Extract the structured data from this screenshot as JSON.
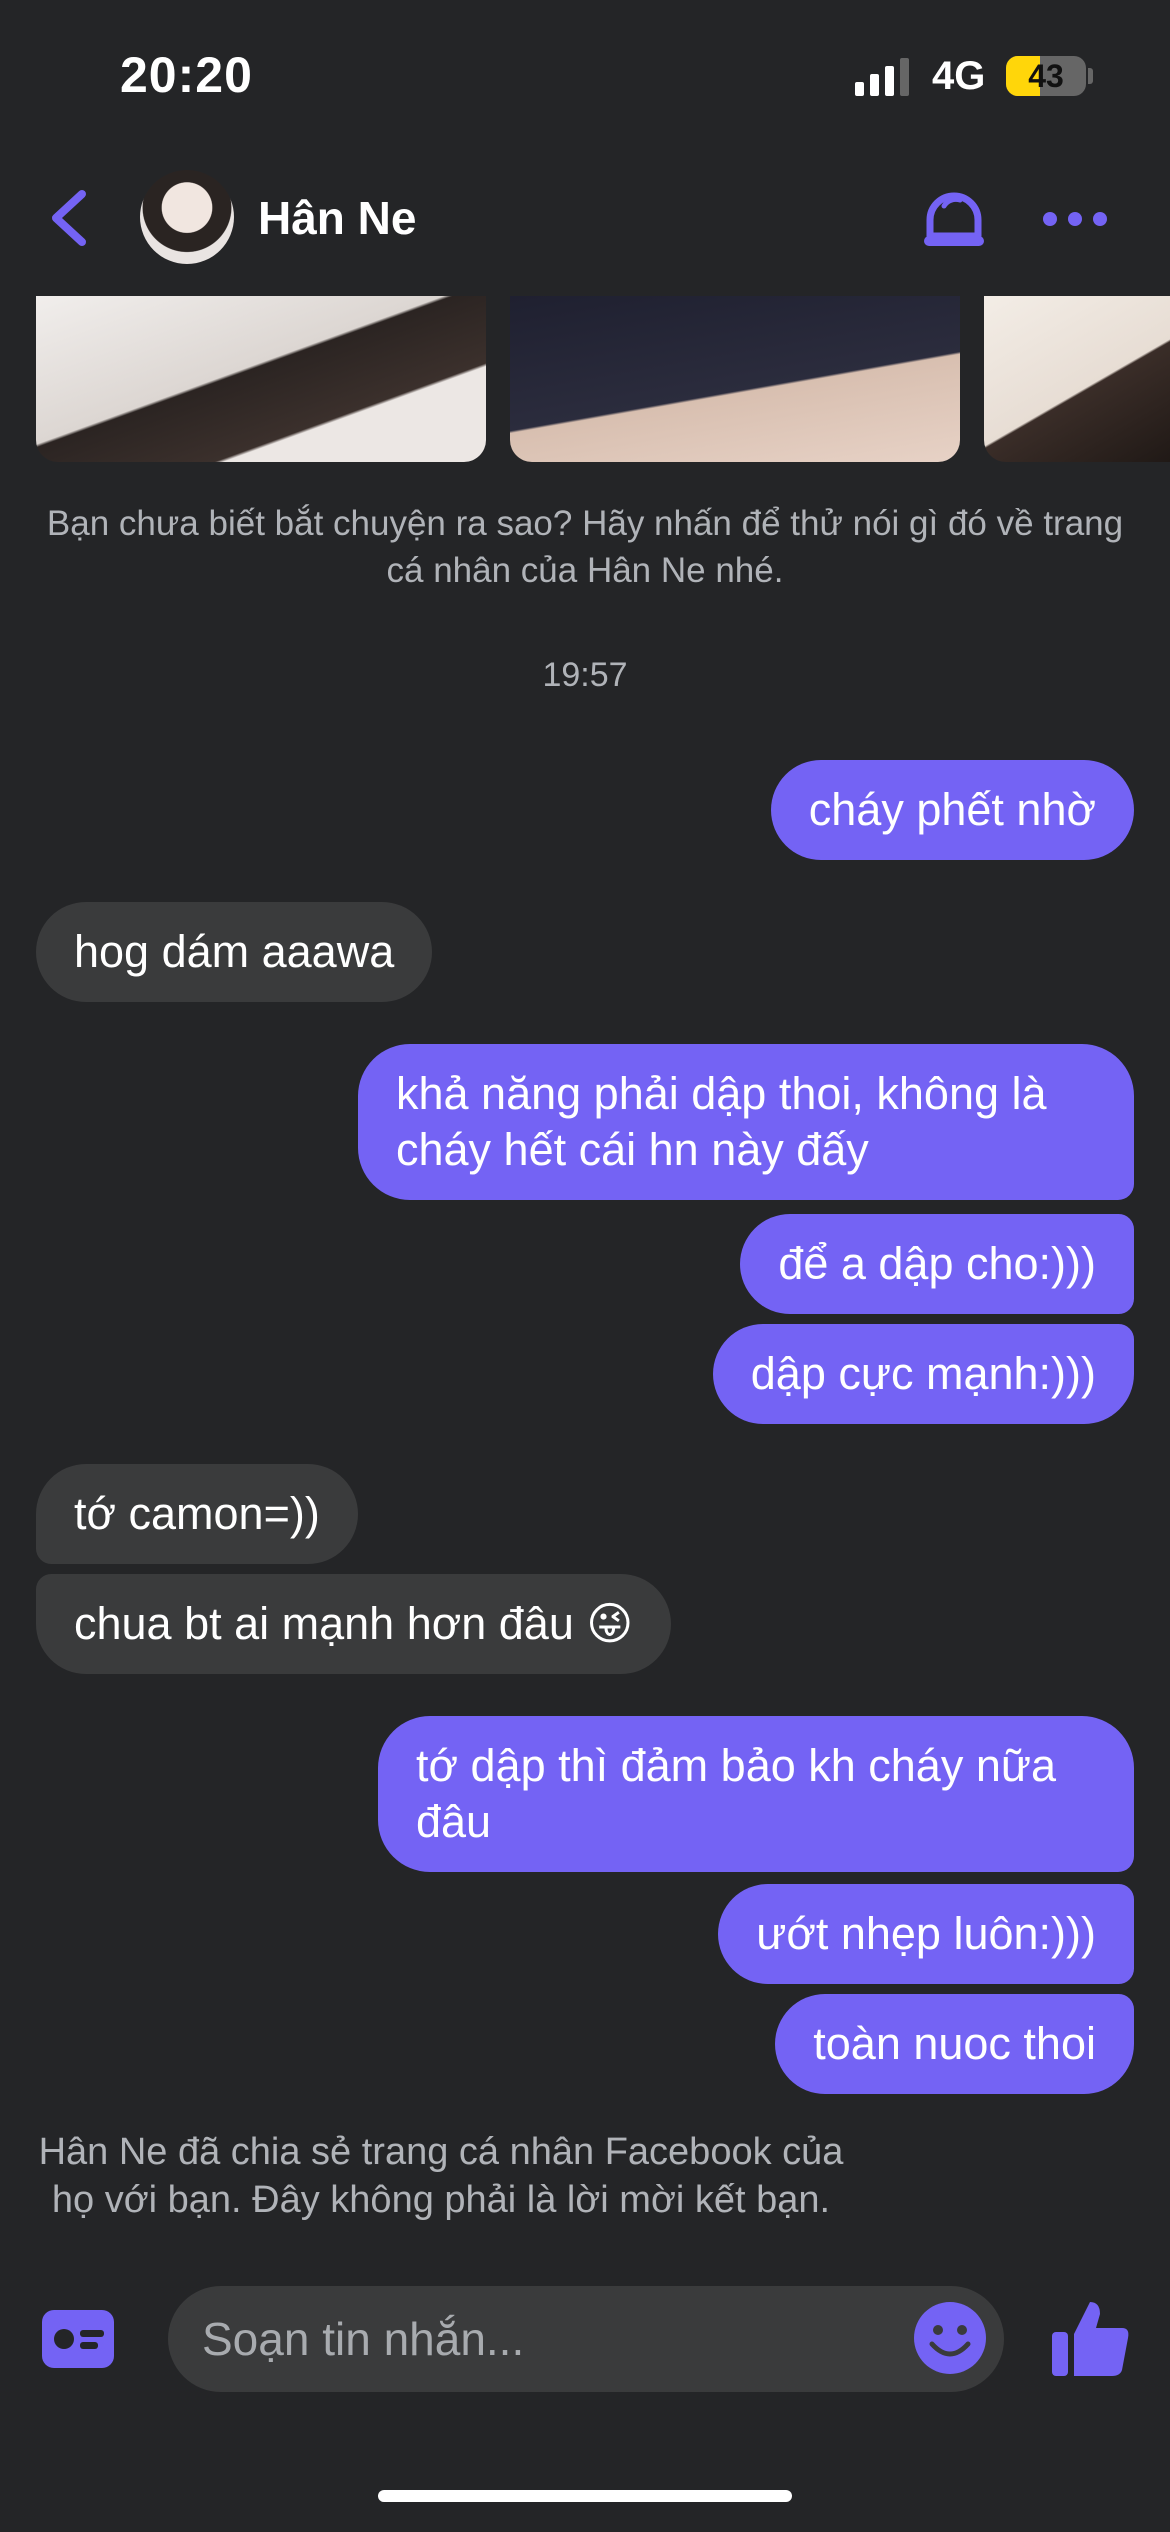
{
  "status_bar": {
    "time": "20:20",
    "network": "4G",
    "battery": "43",
    "battery_level": 0.43
  },
  "header": {
    "contact_name": "Hân Ne",
    "icons": [
      "back-chevron-icon",
      "avatar",
      "bell-icon",
      "more-icon"
    ]
  },
  "intro_text": "Bạn chưa biết bắt chuyện ra sao? Hãy nhấn để thử nói gì đó về trang cá nhân của Hân Ne nhé.",
  "timestamp": "19:57",
  "messages": [
    {
      "from": "me",
      "text": "cháy phết nhờ"
    },
    {
      "from": "them",
      "text": "hog dám aaawa"
    },
    {
      "from": "me",
      "text": "khả năng phải dập thoi, không là cháy hết cái hn này đấy"
    },
    {
      "from": "me",
      "text": "để a dập cho:)))"
    },
    {
      "from": "me",
      "text": "dập cực mạnh:)))"
    },
    {
      "from": "them",
      "text": "tớ camon=))"
    },
    {
      "from": "them",
      "text": "chua bt ai mạnh hơn đâu 😜"
    },
    {
      "from": "me",
      "text": "tớ dập thì đảm bảo kh cháy nữa đâu"
    },
    {
      "from": "me",
      "text": "ướt nhẹp luôn:)))"
    },
    {
      "from": "me",
      "text": "toàn nuoc thoi"
    }
  ],
  "notice": "Hân Ne đã chia sẻ trang cá nhân Facebook của họ với bạn. Đây không phải là lời mời kết bạn.",
  "composer": {
    "placeholder": "Soạn tin nhắn..."
  },
  "colors": {
    "accent": "#7463f4",
    "background": "#242527",
    "incoming_bubble": "#3a3b3c"
  }
}
